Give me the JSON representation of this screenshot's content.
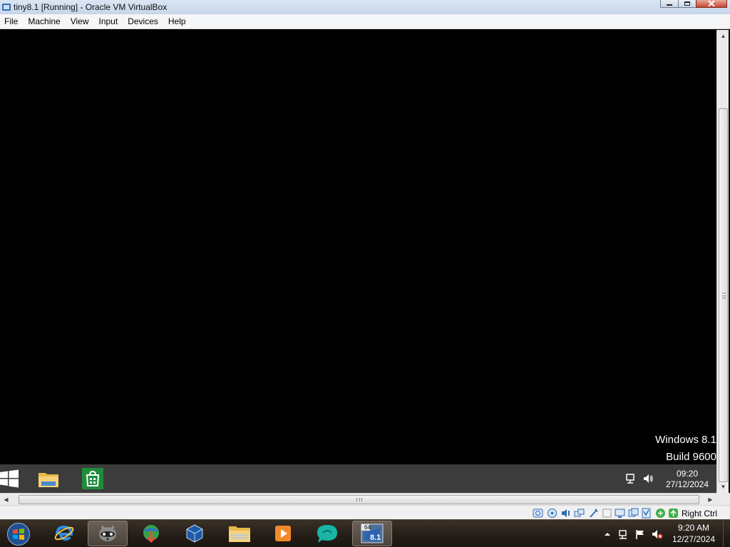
{
  "window": {
    "title": "tiny8.1 [Running] - Oracle VM VirtualBox",
    "icon": "virtualbox-icon"
  },
  "menu": {
    "items": [
      "File",
      "Machine",
      "View",
      "Input",
      "Devices",
      "Help"
    ]
  },
  "guest": {
    "watermark_line1": "Windows 8.1",
    "watermark_line2": "Build 9600",
    "taskbar": {
      "pinned": [
        "start-icon",
        "file-explorer-icon",
        "store-icon"
      ],
      "tray_icons": [
        "network-icon",
        "volume-icon"
      ],
      "time": "09:20",
      "date": "27/12/2024"
    }
  },
  "statusbar": {
    "icons": [
      "hard-disk-icon",
      "optical-drive-icon",
      "audio-icon",
      "network-adapters-icon",
      "usb-icon",
      "shared-folders-icon",
      "display-icon",
      "video-capture-icon",
      "cpu-icon",
      "mouse-integration-icon",
      "keyboard-icon"
    ],
    "host_key": "Right Ctrl"
  },
  "host_taskbar": {
    "apps": [
      "internet-explorer-icon",
      "raccoon-app-icon",
      "internet-download-manager-icon",
      "virtualbox-icon",
      "file-explorer-icon",
      "media-player-icon",
      "chat-bubble-icon",
      "vm-window-icon"
    ],
    "active_app_index": 7,
    "vm_window_badge": "64",
    "vm_window_label": "8.1",
    "tray_icons": [
      "show-hidden-icons-arrow",
      "network-icon",
      "action-center-flag-icon",
      "volume-muted-icon"
    ],
    "time": "9:20 AM",
    "date": "12/27/2024"
  },
  "colors": {
    "guest_taskbar": "#3c3c3c",
    "store_green": "#1e8c3a",
    "host_taskbar": "#241d17"
  }
}
